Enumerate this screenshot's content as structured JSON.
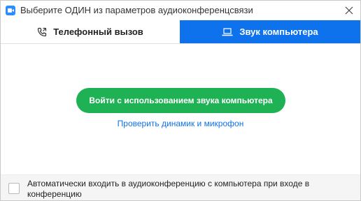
{
  "window": {
    "title": "Выберите ОДИН из параметров аудиоконференцсвязи"
  },
  "tabs": [
    {
      "label": "Телефонный вызов",
      "icon": "phone-icon",
      "active": false
    },
    {
      "label": "Звук компьютера",
      "icon": "laptop-icon",
      "active": true
    }
  ],
  "main": {
    "join_button_label": "Войти с использованием звука компьютера",
    "test_link_label": "Проверить динамик и микрофон"
  },
  "footer": {
    "auto_join_checked": false,
    "auto_join_label": "Автоматически входить в аудиоконференцию с компьютера при входе в конференцию"
  },
  "colors": {
    "accent_blue": "#0e72ed",
    "join_green": "#1fb254",
    "app_icon_blue": "#2d8cff"
  }
}
